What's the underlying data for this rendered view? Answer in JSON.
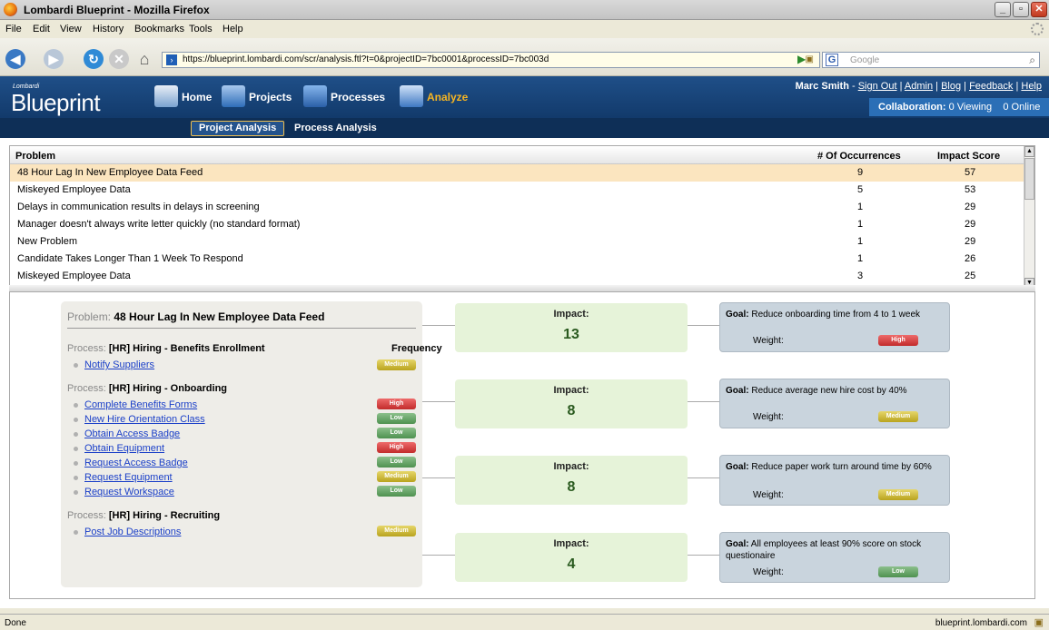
{
  "window": {
    "title": "Lombardi Blueprint - Mozilla Firefox"
  },
  "menu": [
    "File",
    "Edit",
    "View",
    "History",
    "Bookmarks",
    "Tools",
    "Help"
  ],
  "browser": {
    "url": "https://blueprint.lombardi.com/scr/analysis.ftl?t=0&projectID=7bc0001&processID=7bc003d",
    "search_placeholder": "Google",
    "search_engine_icon": "G"
  },
  "app": {
    "logo_small": "Lombardi",
    "logo_big": "Blueprint",
    "nav": {
      "home": "Home",
      "projects": "Projects",
      "processes": "Processes",
      "analyze": "Analyze"
    },
    "user": {
      "name": "Marc Smith",
      "sign_out": "Sign Out",
      "admin": "Admin",
      "blog": "Blog",
      "feedback": "Feedback",
      "help": "Help"
    },
    "collaboration": {
      "label": "Collaboration:",
      "viewing": "0 Viewing",
      "online": "0 Online"
    },
    "subnav": {
      "project_analysis": "Project Analysis",
      "process_analysis": "Process Analysis"
    }
  },
  "table": {
    "headers": {
      "problem": "Problem",
      "occurrences": "# Of Occurrences",
      "impact": "Impact Score"
    },
    "rows": [
      {
        "problem": "48 Hour Lag In New Employee Data Feed",
        "occurrences": "9",
        "impact": "57"
      },
      {
        "problem": "Miskeyed Employee Data",
        "occurrences": "5",
        "impact": "53"
      },
      {
        "problem": "Delays in communication results in delays in screening",
        "occurrences": "1",
        "impact": "29"
      },
      {
        "problem": "Manager doesn't always write letter quickly (no standard format)",
        "occurrences": "1",
        "impact": "29"
      },
      {
        "problem": "New Problem",
        "occurrences": "1",
        "impact": "29"
      },
      {
        "problem": "Candidate Takes Longer Than 1 Week To Respond",
        "occurrences": "1",
        "impact": "26"
      },
      {
        "problem": "Miskeyed Employee Data",
        "occurrences": "3",
        "impact": "25"
      }
    ]
  },
  "detail": {
    "problem_label": "Problem:",
    "problem_title": "48 Hour Lag In New Employee Data Feed",
    "process_label": "Process:",
    "frequency_header": "Frequency",
    "processes": [
      {
        "name": "[HR] Hiring - Benefits Enrollment",
        "activities": [
          {
            "name": "Notify Suppliers",
            "freq": "Medium"
          }
        ]
      },
      {
        "name": "[HR] Hiring - Onboarding",
        "activities": [
          {
            "name": "Complete Benefits Forms",
            "freq": "High"
          },
          {
            "name": "New Hire Orientation Class",
            "freq": "Low"
          },
          {
            "name": "Obtain Access Badge",
            "freq": "Low"
          },
          {
            "name": "Obtain Equipment",
            "freq": "High"
          },
          {
            "name": "Request Access Badge",
            "freq": "Low"
          },
          {
            "name": "Request Equipment",
            "freq": "Medium"
          },
          {
            "name": "Request Workspace",
            "freq": "Low"
          }
        ]
      },
      {
        "name": "[HR] Hiring - Recruiting",
        "activities": [
          {
            "name": "Post Job Descriptions",
            "freq": "Medium"
          }
        ]
      }
    ],
    "impact_label": "Impact:",
    "goal_label": "Goal:",
    "weight_label": "Weight:",
    "goals": [
      {
        "impact": "13",
        "goal": "Reduce onboarding time from 4 to 1 week",
        "weight": "High"
      },
      {
        "impact": "8",
        "goal": "Reduce average new hire cost by 40%",
        "weight": "Medium"
      },
      {
        "impact": "8",
        "goal": "Reduce paper work turn around time by 60%",
        "weight": "Medium"
      },
      {
        "impact": "4",
        "goal": "All employees at least 90% score on stock questionaire",
        "weight": "Low"
      }
    ]
  },
  "status": {
    "text": "Done",
    "domain": "blueprint.lombardi.com"
  },
  "colors": {
    "header": "#1f4f88",
    "subnav": "#0e2f57",
    "selected_row": "#fbe5bf",
    "impact_bg": "#e6f3d9",
    "goal_bg": "#c9d4dd",
    "high": "#c22b2b",
    "medium": "#b9a41e",
    "low": "#4e9150"
  }
}
